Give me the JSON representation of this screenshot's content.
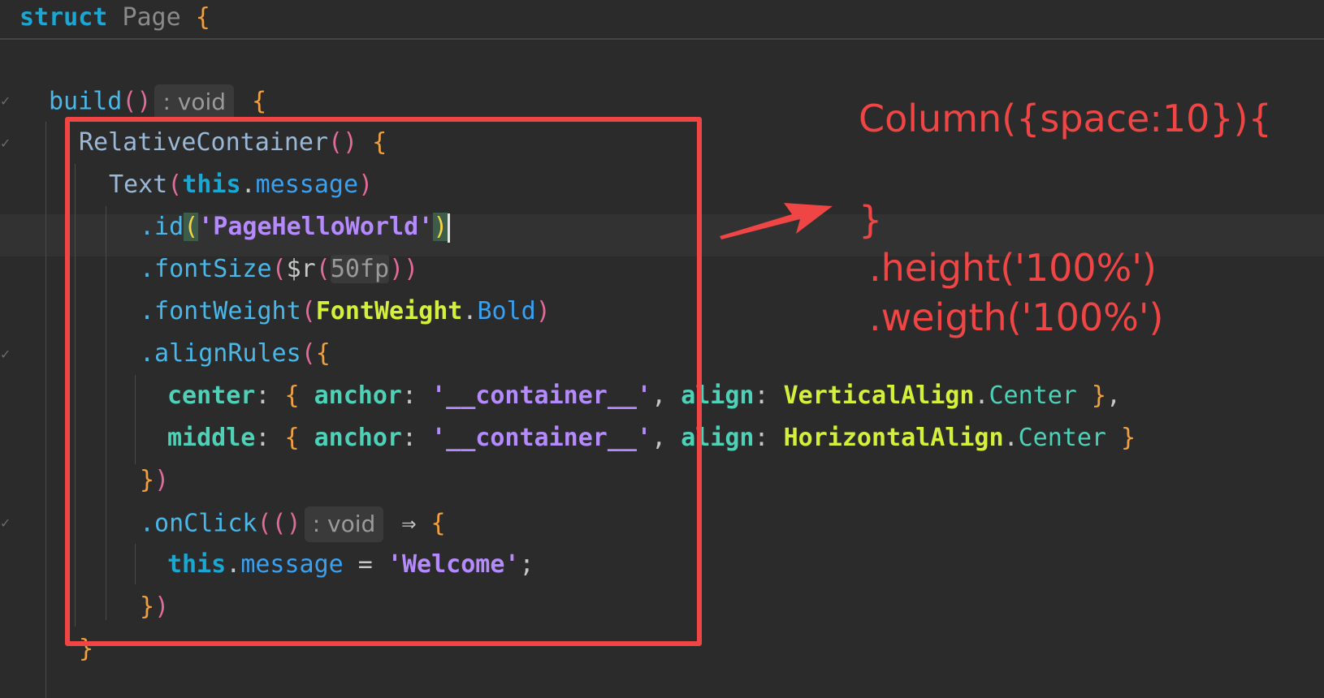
{
  "sticky_header": {
    "keyword": "struct",
    "name": "Page",
    "brace": "{"
  },
  "code": {
    "build": "build",
    "build_parens": "()",
    "void_hint": ": void",
    "open_brace": "{",
    "relative_container": "RelativeContainer",
    "text_call": "Text",
    "this": "this",
    "message": "message",
    "id_method": ".id",
    "id_value": "'PageHelloWorld'",
    "font_size_method": ".fontSize",
    "r_func": "$r",
    "font_size_value": "50fp",
    "font_weight_method": ".fontWeight",
    "font_weight_type": "FontWeight",
    "font_weight_value": "Bold",
    "align_rules_method": ".alignRules",
    "center_key": "center",
    "middle_key": "middle",
    "anchor_key": "anchor",
    "container_value": "'__container__'",
    "align_key": "align",
    "vertical_align": "VerticalAlign",
    "horizontal_align": "HorizontalAlign",
    "center_value": "Center",
    "on_click_method": ".onClick",
    "arrow": "⇒",
    "welcome_value": "'Welcome'",
    "close_obj_paren": "})"
  },
  "annotation": {
    "line1": "Column({space:10}){",
    "line2": "}",
    "line3": ".height('100%')",
    "line4": ".weigth('100%')"
  },
  "colors": {
    "background": "#2b2b2b",
    "annotation_red": "#f04545"
  }
}
